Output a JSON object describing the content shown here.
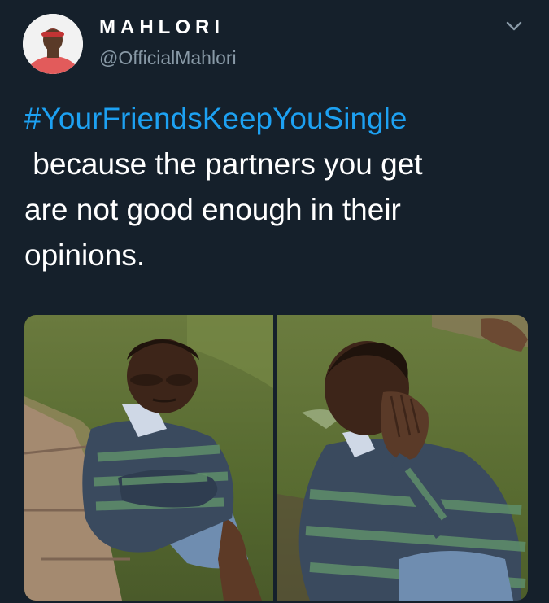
{
  "tweet": {
    "author": {
      "display_name": "MAHLORI",
      "handle": "@OfficialMahlori",
      "avatar_icon": "profile-photo-avatar"
    },
    "menu_icon": "chevron-down-icon",
    "hashtag": "#YourFriendsKeepYouSingle",
    "body_lines": [
      " because the partners you get",
      "are not good enough in their",
      "opinions."
    ],
    "media": {
      "count": 2,
      "images": [
        {
          "subject": "boy-sitting-arms-crossed-photo"
        },
        {
          "subject": "boy-covering-face-photo"
        }
      ]
    }
  },
  "colors": {
    "background": "#15202b",
    "text": "#ffffff",
    "secondary_text": "#8899a6",
    "link": "#1da1f2"
  }
}
